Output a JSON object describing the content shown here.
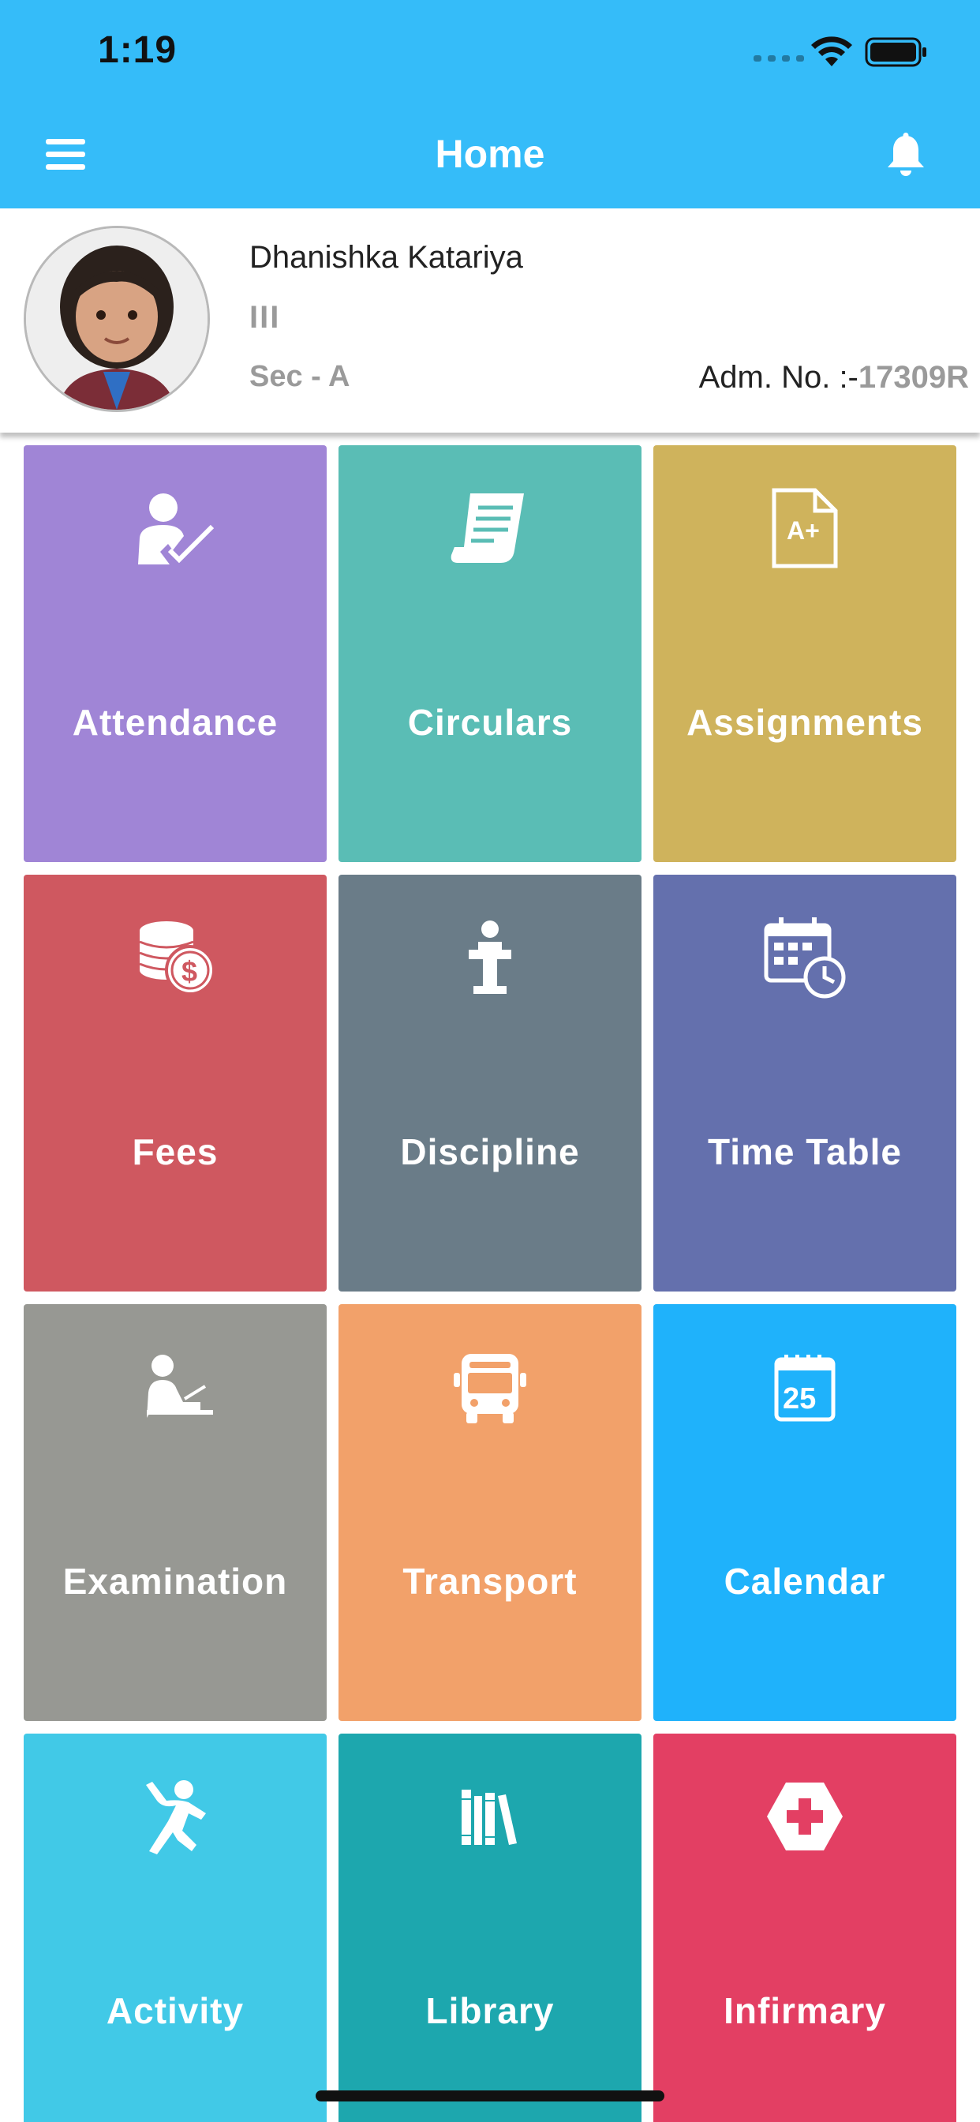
{
  "status_bar": {
    "time": "1:19"
  },
  "nav": {
    "title": "Home",
    "menu_icon": "hamburger-menu-icon",
    "bell_icon": "bell-icon"
  },
  "profile": {
    "name": "Dhanishka Katariya",
    "class": "III",
    "section": "Sec - A",
    "adm_label": "Adm. No. :-",
    "adm_number": "17309R"
  },
  "tiles": [
    {
      "label": "Attendance",
      "color": "#a085d6",
      "icon": "attendance-icon"
    },
    {
      "label": "Circulars",
      "color": "#5abdb5",
      "icon": "circular-icon"
    },
    {
      "label": "Assignments",
      "color": "#cfb35c",
      "icon": "assignment-icon"
    },
    {
      "label": "Fees",
      "color": "#cf5860",
      "icon": "fees-icon"
    },
    {
      "label": "Discipline",
      "color": "#6a7c88",
      "icon": "podium-icon"
    },
    {
      "label": "Time Table",
      "color": "#6470ad",
      "icon": "timetable-icon"
    },
    {
      "label": "Examination",
      "color": "#979893",
      "icon": "examination-icon"
    },
    {
      "label": "Transport",
      "color": "#f2a16a",
      "icon": "bus-icon"
    },
    {
      "label": "Calendar",
      "color": "#1fb2fb",
      "icon": "calendar-icon"
    },
    {
      "label": "Activity",
      "color": "#41c9e7",
      "icon": "activity-icon"
    },
    {
      "label": "Library",
      "color": "#1da7ae",
      "icon": "library-icon"
    },
    {
      "label": "Infirmary",
      "color": "#e33f63",
      "icon": "medical-icon"
    }
  ],
  "calendar_icon_day": "25"
}
